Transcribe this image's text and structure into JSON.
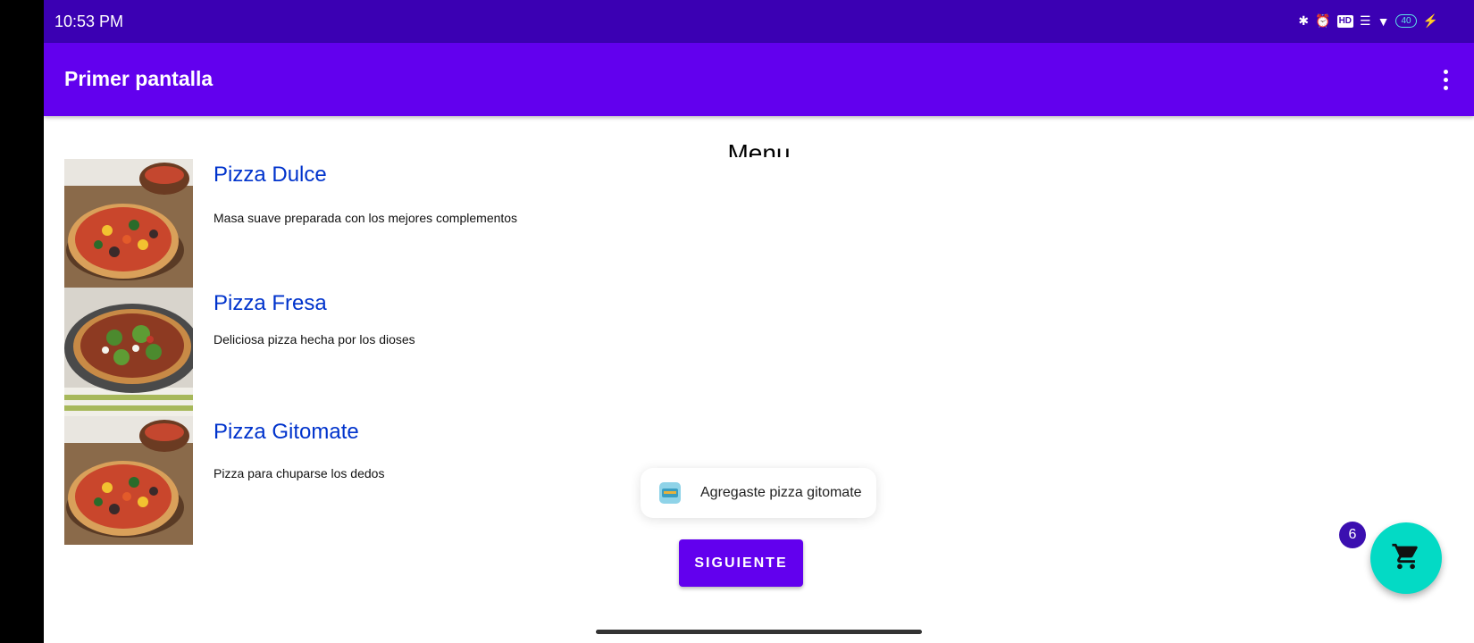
{
  "status_bar": {
    "time": "10:53 PM",
    "icons": [
      "bluetooth-icon",
      "alarm-icon",
      "hd-icon",
      "signal-icon",
      "wifi-icon",
      "battery-icon",
      "charging-icon"
    ],
    "hd_label": "HD",
    "battery_level": "40"
  },
  "app_bar": {
    "title": "Primer pantalla",
    "overflow_icon": "more-vert-icon"
  },
  "menu": {
    "heading": "Menu",
    "items": [
      {
        "title": "Pizza Dulce",
        "description": "Masa suave preparada con los mejores complementos"
      },
      {
        "title": "Pizza Fresa",
        "description": "Deliciosa pizza hecha por los dioses"
      },
      {
        "title": "Pizza Gitomate",
        "description": "Pizza para chuparse los dedos"
      }
    ]
  },
  "toast": {
    "message": "Agregaste pizza gitomate"
  },
  "buttons": {
    "next_label": "SIGUIENTE"
  },
  "cart": {
    "count": "6",
    "icon": "shopping-cart-icon"
  },
  "colors": {
    "status_bar": "#3b00b3",
    "app_bar": "#6200ee",
    "item_title": "#0033cc",
    "fab": "#03dac5",
    "badge": "#3b0fb0"
  }
}
